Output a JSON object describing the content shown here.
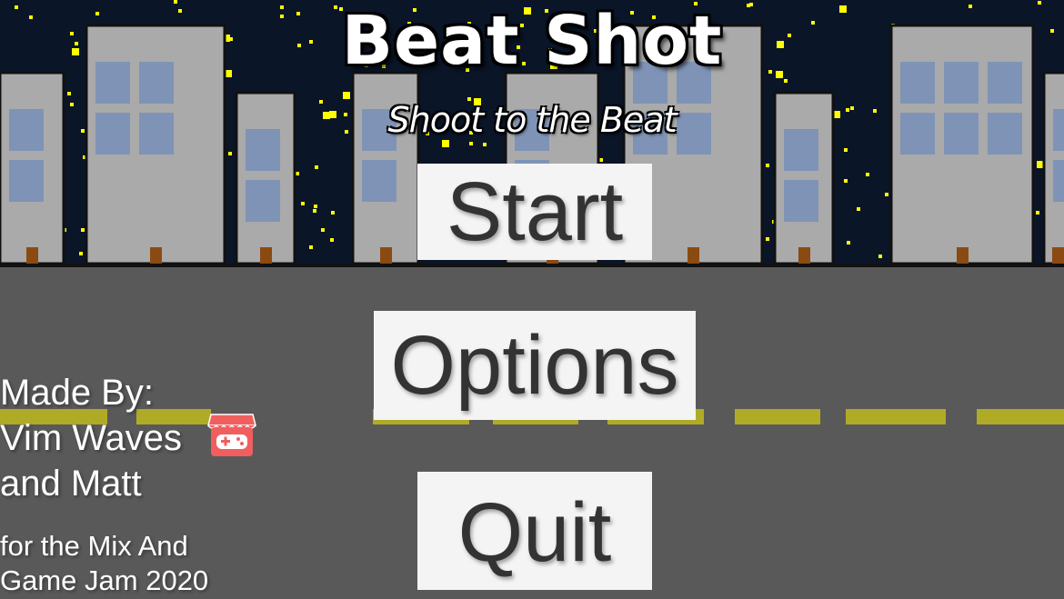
{
  "game": {
    "title": "Beat Shot",
    "subtitle": "Shoot to the Beat"
  },
  "menu": {
    "start_label": "Start",
    "options_label": "Options",
    "quit_label": "Quit"
  },
  "credits": {
    "line1": "Made By:",
    "line2": "Vim Waves",
    "line3": "and Matt",
    "jam_line1": "for the Mix And",
    "jam_line2": "Game Jam 2020",
    "profile_icon": "itch-io-icon"
  },
  "colors": {
    "sky": "#0a1528",
    "road": "#595959",
    "road_line": "#b0ab26",
    "building": "#aaaaaa",
    "window": "#5b7fbf",
    "star": "#ffff00",
    "button_bg": "#f4f4f4",
    "button_text": "#333333",
    "itch_icon": "#f15e5e"
  }
}
